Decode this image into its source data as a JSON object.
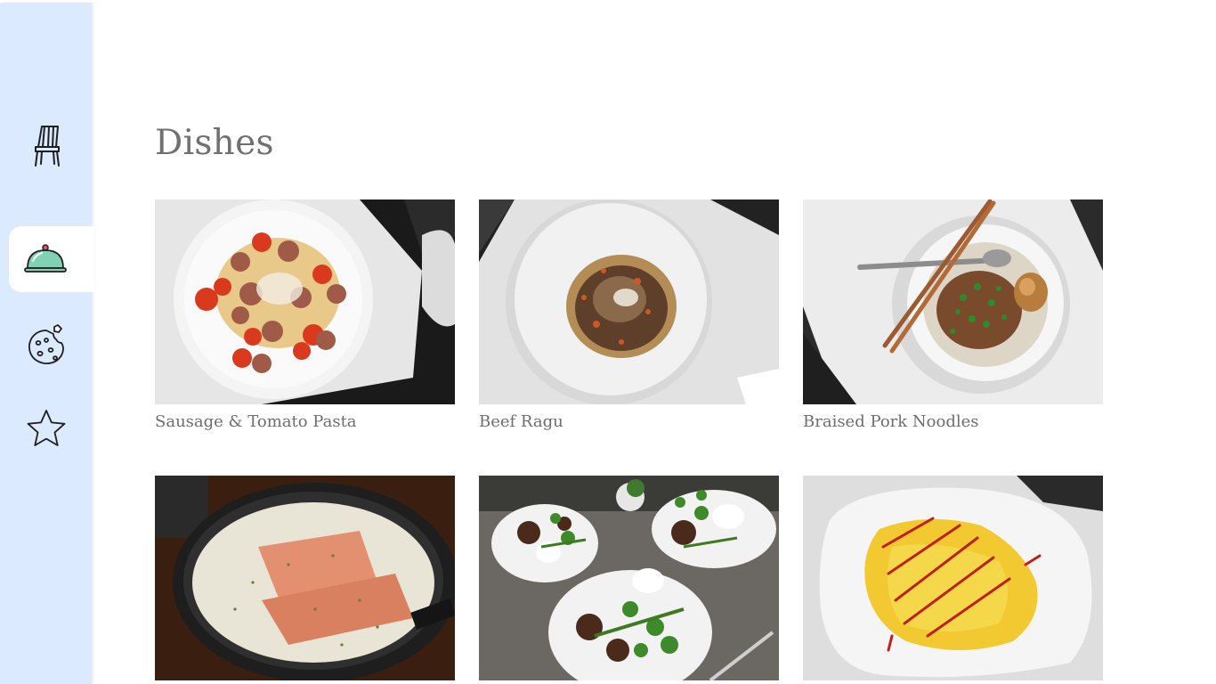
{
  "sidebar": {
    "items": [
      {
        "name": "chair-icon",
        "active": false
      },
      {
        "name": "cloche-icon",
        "active": true
      },
      {
        "name": "cookie-icon",
        "active": false
      },
      {
        "name": "star-icon",
        "active": false
      }
    ]
  },
  "main": {
    "title": "Dishes",
    "dishes": [
      {
        "name": "Sausage & Tomato Pasta"
      },
      {
        "name": "Beef Ragu"
      },
      {
        "name": "Braised Pork Noodles"
      },
      {
        "name": ""
      },
      {
        "name": ""
      },
      {
        "name": ""
      }
    ]
  },
  "colors": {
    "sidebar_bg": "#dbeafe",
    "active_item_bg": "#ffffff",
    "cloche_fill": "#7fd3b4",
    "text": "#6e6e6e"
  }
}
